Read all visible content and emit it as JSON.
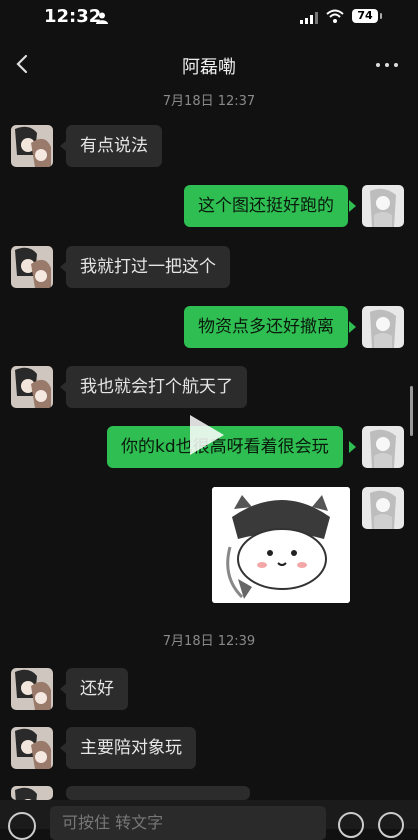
{
  "status_bar": {
    "time": "12:32",
    "battery": "74"
  },
  "nav": {
    "title": "阿磊嘞"
  },
  "timestamps": [
    "7月18日 12:37",
    "7月18日 12:39"
  ],
  "messages": [
    {
      "from": "other",
      "text": "有点说法"
    },
    {
      "from": "me",
      "text": "这个图还挺好跑的"
    },
    {
      "from": "other",
      "text": "我就打过一把这个"
    },
    {
      "from": "me",
      "text": "物资点多还好撤离"
    },
    {
      "from": "other",
      "text": "我也就会打个航天了"
    },
    {
      "from": "me",
      "text": "你的kd也很高呀看着很会玩"
    },
    {
      "from": "me",
      "type": "sticker"
    },
    {
      "from": "other",
      "text": "还好"
    },
    {
      "from": "other",
      "text": "主要陪对象玩"
    }
  ],
  "input": {
    "placeholder": "可按住 转文字"
  },
  "colors": {
    "background": "#111111",
    "bubble_out": "#2fbe52",
    "bubble_in": "#2c2c2c"
  }
}
